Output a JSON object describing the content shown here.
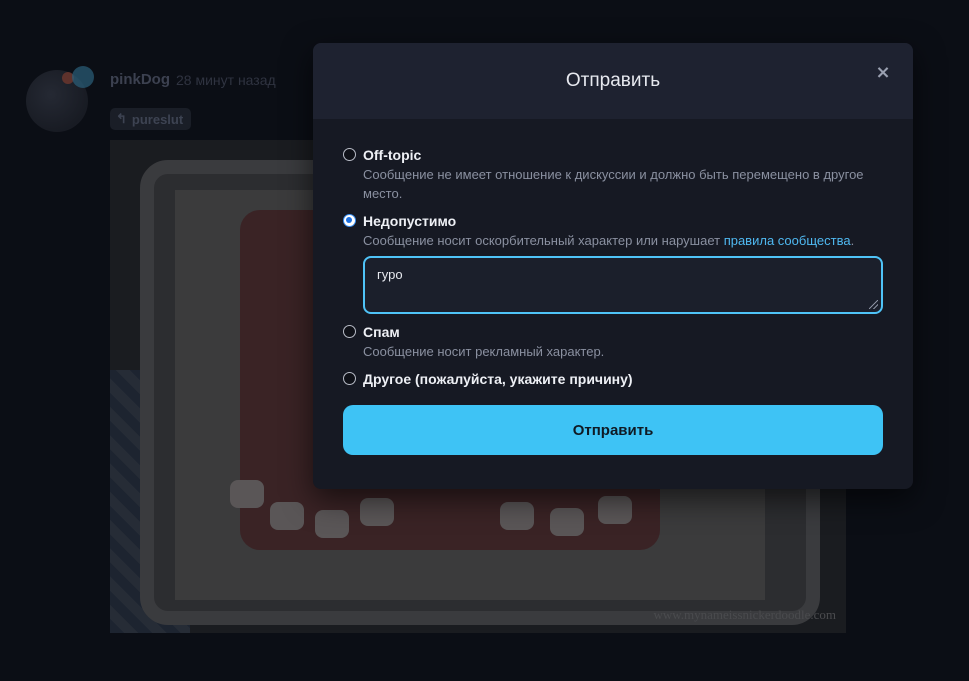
{
  "post": {
    "author": "pinkDog",
    "time": "28 минут назад",
    "reply_to": "pureslut",
    "watermark": "www.mynameissnickerdoodle.com"
  },
  "modal": {
    "title": "Отправить",
    "close_icon": "×",
    "options": [
      {
        "label": "Off-topic",
        "description": "Сообщение не имеет отношение к дискуссии и должно быть перемещено в другое место.",
        "checked": false
      },
      {
        "label": "Недопустимо",
        "description_prefix": "Сообщение носит оскорбительный характер или нарушает ",
        "description_link": "правила сообщества",
        "description_suffix": ".",
        "checked": true
      },
      {
        "label": "Спам",
        "description": "Сообщение носит рекламный характер.",
        "checked": false
      },
      {
        "label": "Другое (пожалуйста, укажите причину)",
        "checked": false
      }
    ],
    "reason_value": "гуро",
    "submit_label": "Отправить"
  },
  "colors": {
    "accent": "#3ec3f5",
    "link": "#4fb8f0",
    "modal_bg": "#161923",
    "header_bg": "#1e2230"
  }
}
